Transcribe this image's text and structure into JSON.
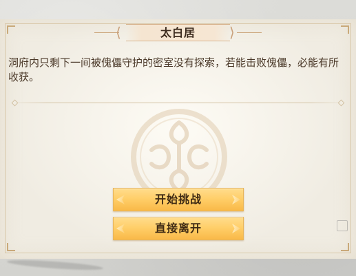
{
  "dialog": {
    "title": "太白居",
    "message": "洞府内只剩下一间被傀儡守护的密室没有探索，若能击败傀儡，必能有所收获。"
  },
  "buttons": {
    "challenge_label": "开始挑战",
    "leave_label": "直接离开"
  },
  "colors": {
    "button_gold": "#ffcf6a",
    "title_text": "#3b2a1d",
    "body_text": "#4a3828",
    "frame": "#d8c6a6"
  }
}
